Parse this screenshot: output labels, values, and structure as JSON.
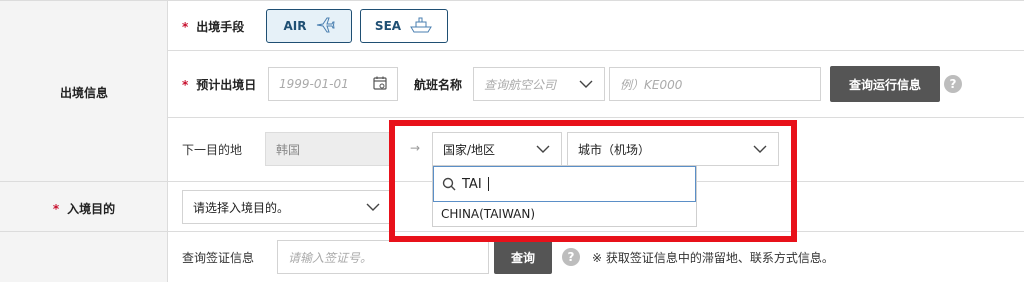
{
  "sections": {
    "departure_info_label": "出境信息",
    "entry_purpose_label": "入境目的"
  },
  "departure_method": {
    "label": "出境手段",
    "options": [
      {
        "label": "AIR",
        "icon": "airplane-icon",
        "selected": true
      },
      {
        "label": "SEA",
        "icon": "ship-icon",
        "selected": false
      }
    ]
  },
  "departure_date": {
    "label": "预计出境日",
    "placeholder": "1999-01-01"
  },
  "flight": {
    "label": "航班名称",
    "airline_placeholder": "查询航空公司",
    "flight_no_placeholder": "例）KE000",
    "query_button": "查询运行信息"
  },
  "next_destination": {
    "label": "下一目的地",
    "current_value": "韩国",
    "arrow": "→",
    "country_select": "国家/地区",
    "city_select": "城市（机场）"
  },
  "dropdown": {
    "search_value": "TAI",
    "options": [
      "CHINA(TAIWAN)"
    ]
  },
  "entry_purpose": {
    "select_value": "请选择入境目的。"
  },
  "visa": {
    "label": "查询签证信息",
    "placeholder": "请输入签证号。",
    "query_button": "查询",
    "note": "※ 获取签证信息中的滞留地、联系方式信息。"
  },
  "help_glyph": "?",
  "required_mark": "*",
  "colors": {
    "highlight": "#e8111a",
    "required": "#c8102e",
    "accent": "#1f4f73",
    "dark_button": "#555555"
  }
}
